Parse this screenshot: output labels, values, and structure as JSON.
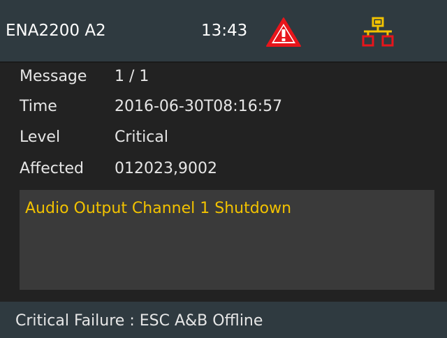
{
  "header": {
    "device_name": "ENA2200 A2",
    "time": "13:43",
    "warning_icon": "warning-triangle-icon",
    "network_icon": "network-topology-icon",
    "warning_color": "#e8151b",
    "network_colors": {
      "top": "#f2c200",
      "bottom": "#e8151b"
    }
  },
  "message": {
    "label": "Message",
    "value": "1 / 1"
  },
  "details": {
    "time_label": "Time",
    "time_value": "2016-06-30T08:16:57",
    "level_label": "Level",
    "level_value": "Critical",
    "affected_label": "Affected",
    "affected_value": "012023,9002"
  },
  "panel": {
    "text": "Audio Output Channel 1 Shutdown",
    "text_color": "#f2c200"
  },
  "footer": {
    "status": "Critical Failure : ESC A&B Offline"
  }
}
